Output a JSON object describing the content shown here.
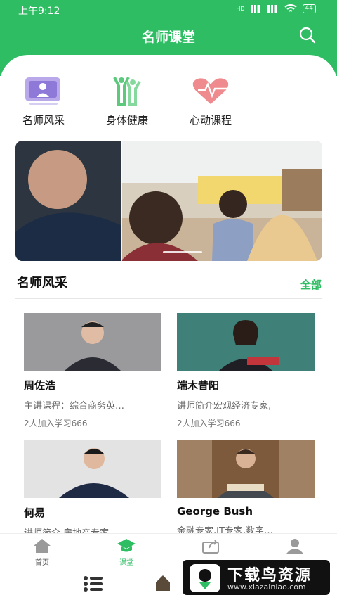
{
  "status": {
    "time": "上午9:12",
    "battery": "44",
    "hd": "HD"
  },
  "header": {
    "title": "名师课堂"
  },
  "categories": [
    {
      "label": "名师风采",
      "icon": "teacher-screen-icon"
    },
    {
      "label": "身体健康",
      "icon": "people-health-icon"
    },
    {
      "label": "心动课程",
      "icon": "heart-pulse-icon"
    }
  ],
  "section": {
    "title": "名师风采",
    "all": "全部"
  },
  "teachers": [
    {
      "name": "周佐浩",
      "desc": "主讲课程：综合商务英…",
      "count": "2人加入学习666"
    },
    {
      "name": "端木昔阳",
      "desc": "讲师简介宏观经济专家,",
      "count": "2人加入学习666"
    },
    {
      "name": "何易",
      "desc": "讲师简介,房地产专家"
    },
    {
      "name": "George Bush",
      "desc": "金融专家,IT专家,数字…"
    }
  ],
  "tabs": [
    {
      "label": "首页",
      "icon": "home-icon"
    },
    {
      "label": "课堂",
      "icon": "classroom-icon",
      "active": true
    },
    {
      "label": "",
      "icon": "share-icon"
    },
    {
      "label": "",
      "icon": "user-icon"
    }
  ],
  "watermark": {
    "title": "下载鸟资源",
    "url": "www.xiazainiao.com"
  },
  "colors": {
    "brand": "#2fbd64"
  }
}
